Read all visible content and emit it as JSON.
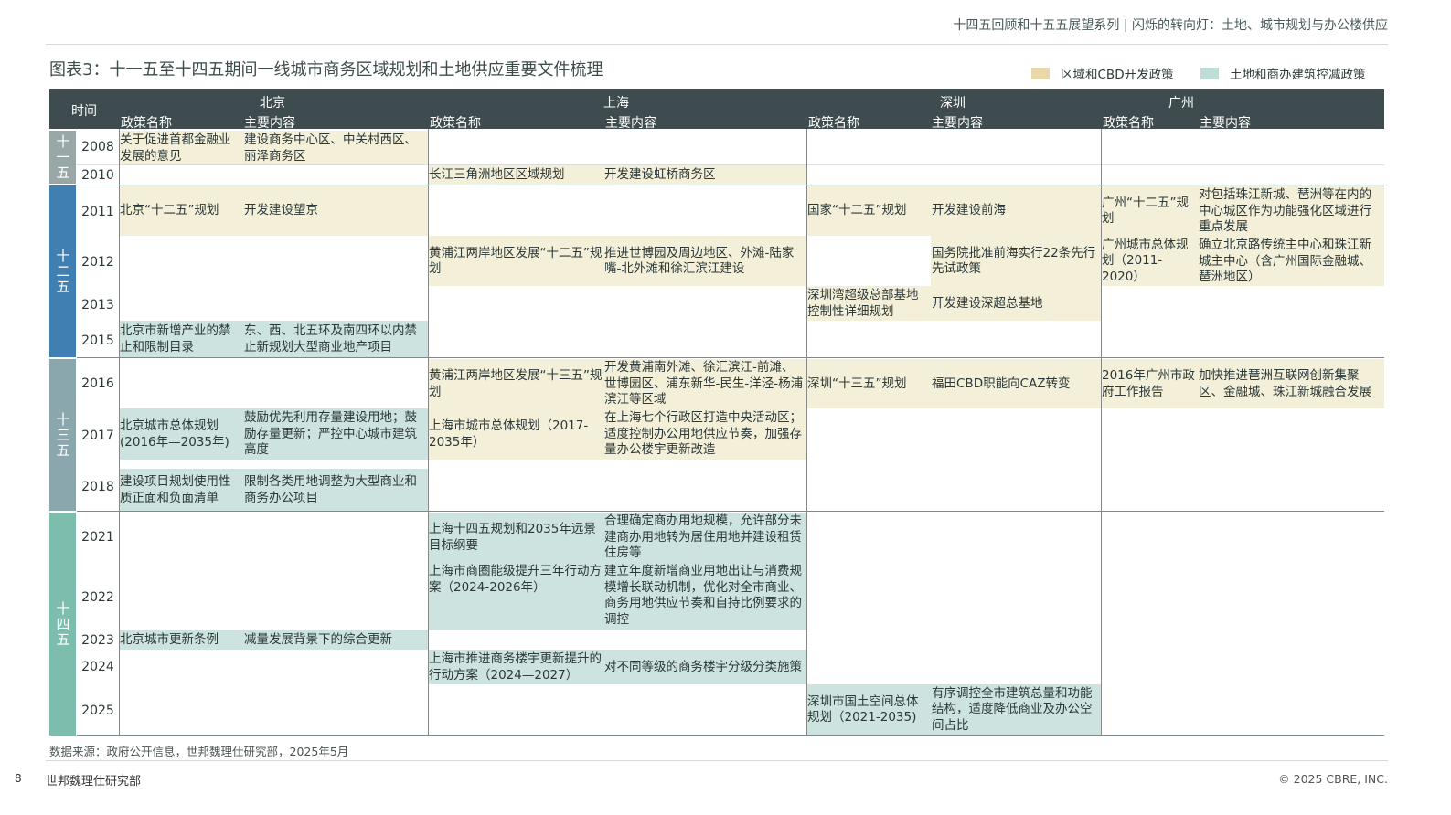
{
  "header": {
    "series": "十四五回顾和十五五展望系列 | 闪烁的转向灯：土地、城市规划与办公楼供应",
    "title": "图表3：十一五至十四五期间一线城市商务区域规划和土地供应重要文件梳理"
  },
  "legend": {
    "cbd_label": "区域和CBD开发政策",
    "land_label": "土地和商办建筑控减政策",
    "cbd_color": "#f3efd9",
    "land_color": "#cde3df"
  },
  "table": {
    "time_label": "时间",
    "col_name": "政策名称",
    "col_content": "主要内容",
    "cities": [
      "北京",
      "上海",
      "深圳",
      "广州"
    ],
    "eras": [
      "十一五",
      "十二五",
      "十三五",
      "十四五"
    ],
    "era_colors": [
      "#9aa7a7",
      "#3f7fb1",
      "#8aa7ad",
      "#7dbdad"
    ],
    "years": [
      "2008",
      "2010",
      "2011",
      "2012",
      "2013",
      "2015",
      "2016",
      "2017",
      "2018",
      "2021",
      "2022",
      "2023",
      "2024",
      "2025"
    ],
    "cells": [
      {
        "id": "bj2008n",
        "text": "关于促进首都金融业发展的意见"
      },
      {
        "id": "bj2008c",
        "text": "建设商务中心区、中关村西区、丽泽商务区"
      },
      {
        "id": "sh2010n",
        "text": "长江三角洲地区区域规划"
      },
      {
        "id": "sh2010c",
        "text": "开发建设虹桥商务区"
      },
      {
        "id": "bj2011n",
        "text": "北京“十二五”规划"
      },
      {
        "id": "bj2011c",
        "text": "开发建设望京"
      },
      {
        "id": "sz2011n",
        "text": "国家“十二五”规划"
      },
      {
        "id": "sz2011c",
        "text": "开发建设前海"
      },
      {
        "id": "gz2011n",
        "text": "广州“十二五”规划"
      },
      {
        "id": "gz2011c",
        "text": "对包括珠江新城、琶洲等在内的中心城区作为功能强化区域进行重点发展"
      },
      {
        "id": "sh2012n",
        "text": "黄浦江两岸地区发展“十二五”规划"
      },
      {
        "id": "sh2012c",
        "text": "推进世博园及周边地区、外滩-陆家嘴-北外滩和徐汇滨江建设"
      },
      {
        "id": "sz2012c",
        "text": "国务院批准前海实行22条先行先试政策"
      },
      {
        "id": "gz2012n",
        "text": "广州城市总体规划（2011-2020）"
      },
      {
        "id": "gz2012c",
        "text": "确立北京路传统主中心和珠江新城主中心（含广州国际金融城、琶洲地区）"
      },
      {
        "id": "sz2013n",
        "text": "深圳湾超级总部基地控制性详细规划"
      },
      {
        "id": "sz2013c",
        "text": "开发建设深超总基地"
      },
      {
        "id": "bj2015n",
        "text": "北京市新增产业的禁止和限制目录"
      },
      {
        "id": "bj2015c",
        "text": "东、西、北五环及南四环以内禁止新规划大型商业地产项目"
      },
      {
        "id": "sh2016n",
        "text": "黄浦江两岸地区发展“十三五”规划"
      },
      {
        "id": "sh2016c",
        "text": "开发黄浦南外滩、徐汇滨江-前滩、世博园区、浦东新华-民生-洋泾-杨浦滨江等区域"
      },
      {
        "id": "sz2016n",
        "text": "深圳“十三五”规划"
      },
      {
        "id": "sz2016c",
        "text": "福田CBD职能向CAZ转变"
      },
      {
        "id": "gz2016n",
        "text": "2016年广州市政府工作报告"
      },
      {
        "id": "gz2016c",
        "text": "加快推进琶洲互联网创新集聚区、金融城、珠江新城融合发展"
      },
      {
        "id": "bj2017n",
        "text": "北京城市总体规划(2016年—2035年)"
      },
      {
        "id": "bj2017c",
        "text": "鼓励优先利用存量建设用地；鼓励存量更新；严控中心城市建筑高度"
      },
      {
        "id": "sh2017n",
        "text": "上海市城市总体规划（2017-2035年）"
      },
      {
        "id": "sh2017c",
        "text": "在上海七个行政区打造中央活动区；适度控制办公用地供应节奏，加强存量办公楼宇更新改造"
      },
      {
        "id": "bj2018n",
        "text": "建设项目规划使用性质正面和负面清单"
      },
      {
        "id": "bj2018c",
        "text": "限制各类用地调整为大型商业和商务办公项目"
      },
      {
        "id": "sh2021n",
        "text": "上海十四五规划和2035年远景目标纲要"
      },
      {
        "id": "sh2021c",
        "text": "合理确定商办用地规模，允许部分未建商办用地转为居住用地并建设租赁住房等"
      },
      {
        "id": "sh2022n",
        "text": "上海市商圈能级提升三年行动方案（2024-2026年）"
      },
      {
        "id": "sh2022c",
        "text": "建立年度新增商业用地出让与消费规模增长联动机制，优化对全市商业、商务用地供应节奏和自持比例要求的调控"
      },
      {
        "id": "bj2023n",
        "text": "北京城市更新条例"
      },
      {
        "id": "bj2023c",
        "text": "减量发展背景下的综合更新"
      },
      {
        "id": "sh2024n",
        "text": "上海市推进商务楼宇更新提升的行动方案（2024—2027）"
      },
      {
        "id": "sh2024c",
        "text": "对不同等级的商务楼宇分级分类施策"
      },
      {
        "id": "sz2025n",
        "text": "深圳市国土空间总体规划（2021-2035)"
      },
      {
        "id": "sz2025c",
        "text": "有序调控全市建筑总量和功能结构，适度降低商业及办公空间占比"
      }
    ]
  },
  "footer": {
    "source": "数据来源：政府公开信息，世邦魏理仕研究部，2025年5月",
    "page": "8",
    "org": "世邦魏理仕研究部",
    "copyright": "© 2025 CBRE, INC."
  }
}
